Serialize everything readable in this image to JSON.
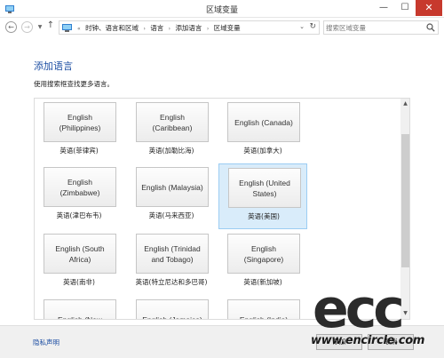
{
  "window": {
    "title": "区域变量"
  },
  "navbar": {
    "breadcrumbs": [
      "时钟、语言和区域",
      "语言",
      "添加语言",
      "区域变量"
    ],
    "search_placeholder": "搜索区域变量"
  },
  "main": {
    "title": "添加语言",
    "instruction": "使用搜索框查找更多语言。"
  },
  "languages": [
    {
      "name": "English (Philippines)",
      "native": "英语(菲律宾)",
      "selected": false
    },
    {
      "name": "English (Caribbean)",
      "native": "英语(加勒比海)",
      "selected": false
    },
    {
      "name": "English (Canada)",
      "native": "英语(加拿大)",
      "selected": false
    },
    {
      "name": "English (Zimbabwe)",
      "native": "英语(津巴布韦)",
      "selected": false
    },
    {
      "name": "English (Malaysia)",
      "native": "英语(马来西亚)",
      "selected": false
    },
    {
      "name": "English (United States)",
      "native": "英语(美国)",
      "selected": true
    },
    {
      "name": "English (South Africa)",
      "native": "英语(南非)",
      "selected": false
    },
    {
      "name": "English (Trinidad and Tobago)",
      "native": "英语(特立尼达和多巴哥)",
      "selected": false
    },
    {
      "name": "English (Singapore)",
      "native": "英语(新加坡)",
      "selected": false
    },
    {
      "name": "English (New",
      "native": "",
      "selected": false
    },
    {
      "name": "English (Jamaica)",
      "native": "",
      "selected": false
    },
    {
      "name": "English (India)",
      "native": "",
      "selected": false
    }
  ],
  "footer": {
    "privacy_link": "隐私声明",
    "add_button": "添加",
    "cancel_button": "取消"
  },
  "watermark": {
    "letters": "ecc",
    "url": "www.encircle.com"
  }
}
